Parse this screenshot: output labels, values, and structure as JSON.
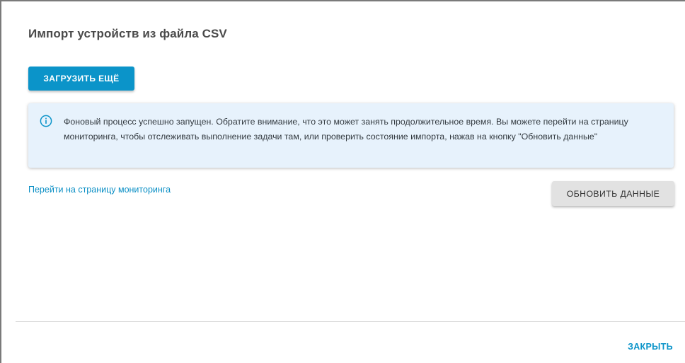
{
  "dialog": {
    "title": "Импорт устройств из файла CSV"
  },
  "actions": {
    "upload_more_label": "ЗАГРУЗИТЬ ЕЩЁ",
    "refresh_label": "ОБНОВИТЬ ДАННЫЕ",
    "close_label": "ЗАКРЫТЬ"
  },
  "alert": {
    "icon": "info-icon",
    "message": "Фоновый процесс успешно запущен. Обратите внимание, что это может занять продолжительное время. Вы можете перейти на страницу мониторинга, чтобы отслеживать выполнение задачи там, или проверить состояние импорта, нажав на кнопку \"Обновить данные\""
  },
  "monitoring_link_label": "Перейти на страницу мониторинга",
  "colors": {
    "accent": "#0b94c9",
    "alert_background": "#e7f2fc",
    "secondary_button": "#e2e2e2"
  }
}
